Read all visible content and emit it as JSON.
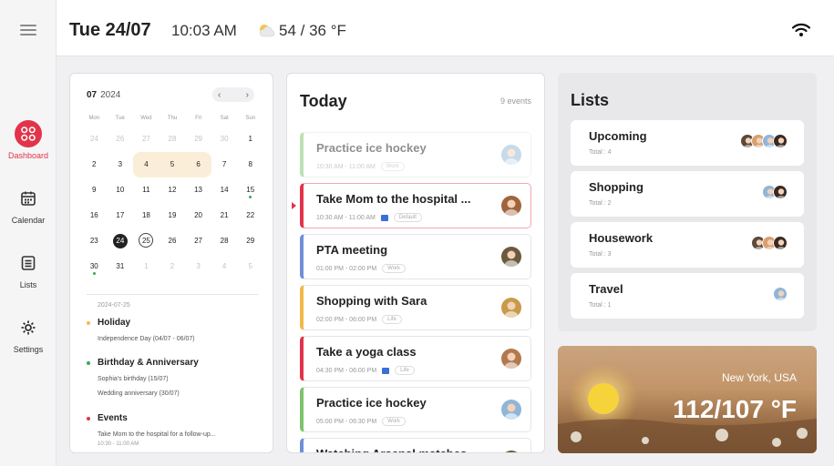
{
  "header": {
    "date": "Tue 24/07",
    "time": "10:03 AM",
    "weather_icon": "partly-cloudy-icon",
    "temperature": "54 / 36 °F"
  },
  "sidebar": {
    "items": [
      {
        "label": "Dashboard",
        "icon": "dashboard-icon",
        "active": true
      },
      {
        "label": "Calendar",
        "icon": "calendar-icon",
        "active": false
      },
      {
        "label": "Lists",
        "icon": "lists-icon",
        "active": false
      },
      {
        "label": "Settings",
        "icon": "gear-icon",
        "active": false
      }
    ]
  },
  "calendar": {
    "month": "07",
    "year": "2024",
    "prev_label": "‹",
    "next_label": "›",
    "weekdays": [
      "Mon",
      "Tue",
      "Wed",
      "Thu",
      "Fri",
      "Sat",
      "Sun"
    ],
    "days": [
      {
        "n": "24",
        "m": true
      },
      {
        "n": "26",
        "m": true
      },
      {
        "n": "27",
        "m": true
      },
      {
        "n": "28",
        "m": true
      },
      {
        "n": "29",
        "m": true
      },
      {
        "n": "30",
        "m": true
      },
      {
        "n": "1"
      },
      {
        "n": "2"
      },
      {
        "n": "3"
      },
      {
        "n": "4",
        "hl": "first"
      },
      {
        "n": "5",
        "hl": "mid"
      },
      {
        "n": "6",
        "hl": "last"
      },
      {
        "n": "7"
      },
      {
        "n": "8"
      },
      {
        "n": "9"
      },
      {
        "n": "10"
      },
      {
        "n": "11"
      },
      {
        "n": "12"
      },
      {
        "n": "13"
      },
      {
        "n": "14"
      },
      {
        "n": "15",
        "dot": true
      },
      {
        "n": "16"
      },
      {
        "n": "17"
      },
      {
        "n": "18"
      },
      {
        "n": "19"
      },
      {
        "n": "20"
      },
      {
        "n": "21"
      },
      {
        "n": "22"
      },
      {
        "n": "23"
      },
      {
        "n": "24",
        "today": true
      },
      {
        "n": "25",
        "sel": true
      },
      {
        "n": "26"
      },
      {
        "n": "27"
      },
      {
        "n": "28"
      },
      {
        "n": "29"
      },
      {
        "n": "30",
        "dot": true
      },
      {
        "n": "31"
      },
      {
        "n": "1",
        "m": true
      },
      {
        "n": "2",
        "m": true
      },
      {
        "n": "3",
        "m": true
      },
      {
        "n": "4",
        "m": true
      },
      {
        "n": "5",
        "m": true
      }
    ],
    "selected_date": "2024-07-25",
    "sections": [
      {
        "title": "Holiday",
        "color": "#f2b84b",
        "lines": [
          "Independence Day (04/07 - 06/07)"
        ]
      },
      {
        "title": "Birthday & Anniversary",
        "color": "#3aa655",
        "lines": [
          "Sophia's birthday (15/07)",
          "Wedding anniversary (30/07)"
        ]
      },
      {
        "title": "Events",
        "color": "#e2334a",
        "lines": [
          "Take Mom to the hospital for a follow-up...",
          "10:30 - 11:00 AM"
        ]
      }
    ]
  },
  "today": {
    "title": "Today",
    "count": "9 events",
    "events": [
      {
        "title": "Practice ice hockey",
        "time": "10:30 AM - 11:00 AM",
        "tag": "Work",
        "color": "#7dc36b",
        "state": "past",
        "cal": false,
        "avatar": "#8fb6d8"
      },
      {
        "title": "Take Mom to the hospital ...",
        "time": "10:30 AM - 11:00 AM",
        "tag": "Default",
        "color": "#e2334a",
        "state": "current",
        "cal": true,
        "avatar": "#a0643c"
      },
      {
        "title": "PTA meeting",
        "time": "01:00 PM - 02:00 PM",
        "tag": "Work",
        "color": "#6f8fd8",
        "state": "",
        "cal": false,
        "avatar": "#6b5a3e"
      },
      {
        "title": "Shopping with Sara",
        "time": "02:00 PM - 06:00 PM",
        "tag": "Life",
        "color": "#f2b84b",
        "state": "",
        "cal": false,
        "avatar": "#c89a4a"
      },
      {
        "title": "Take a yoga class",
        "time": "04:30 PM - 06:00 PM",
        "tag": "Life",
        "color": "#e2334a",
        "state": "",
        "cal": true,
        "avatar": "#b4784e"
      },
      {
        "title": "Practice ice hockey",
        "time": "05:00 PM - 06:30 PM",
        "tag": "Work",
        "color": "#7dc36b",
        "state": "",
        "cal": false,
        "avatar": "#8fb6d8"
      },
      {
        "title": "Watching Arsenal matches...",
        "time": "",
        "tag": "",
        "color": "#6f8fd8",
        "state": "",
        "cal": false,
        "avatar": "#6b5a3e"
      }
    ]
  },
  "lists": {
    "title": "Lists",
    "items": [
      {
        "name": "Upcoming",
        "total": "Total : 4",
        "avatars": [
          "#5b4a3a",
          "#d8a070",
          "#8fb6d8",
          "#3a2a22"
        ]
      },
      {
        "name": "Shopping",
        "total": "Total : 2",
        "avatars": [
          "#8fb6d8",
          "#3a2a22"
        ]
      },
      {
        "name": "Housework",
        "total": "Total : 3",
        "avatars": [
          "#5b4a3a",
          "#d8a070",
          "#3a2a22"
        ]
      },
      {
        "name": "Travel",
        "total": "Total : 1",
        "avatars": [
          "#8fb6d8"
        ]
      }
    ]
  },
  "weather": {
    "city": "New York, USA",
    "temperature": "112/107 °F"
  }
}
